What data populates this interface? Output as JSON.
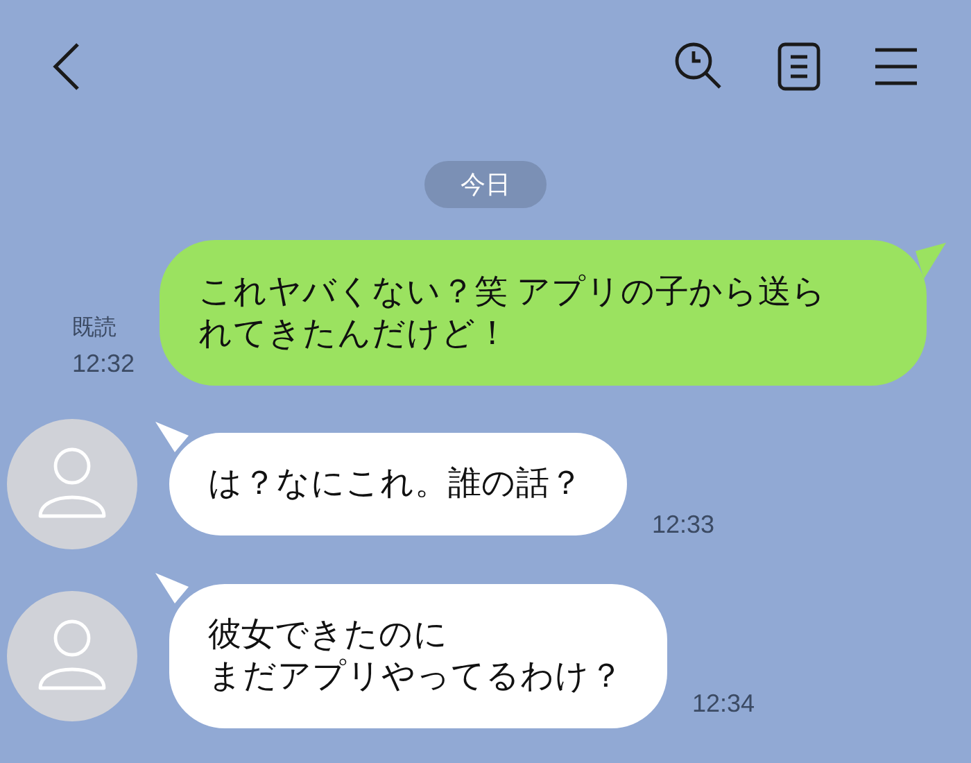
{
  "header": {
    "actions": [
      {
        "kind": "search"
      },
      {
        "kind": "notes"
      },
      {
        "kind": "menu"
      }
    ]
  },
  "date_label": "今日",
  "messages": [
    {
      "kind": "sent",
      "lines": [
        "これヤバくない？笑 アプリの子から送ら",
        "れてきたんだけど！"
      ],
      "read_label": "既読",
      "time": "12:32"
    },
    {
      "kind": "received",
      "lines": [
        "は？なにこれ。誰の話？"
      ],
      "time": "12:33"
    },
    {
      "kind": "received",
      "lines": [
        "彼女できたのに",
        "まだアプリやってるわけ？"
      ],
      "time": "12:34"
    }
  ]
}
